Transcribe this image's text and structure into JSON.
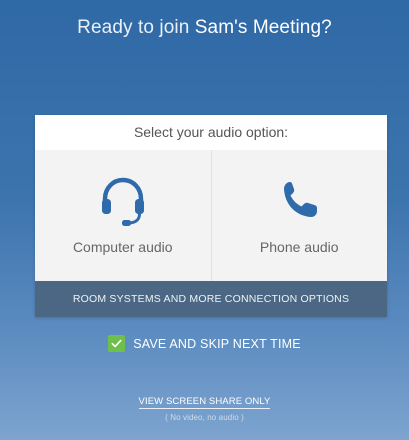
{
  "title": {
    "prefix": "Ready to join ",
    "meeting_name": "Sam's Meeting?"
  },
  "audio_card": {
    "header": "Select your audio option:",
    "options": [
      {
        "label": "Computer audio",
        "icon": "headset-icon"
      },
      {
        "label": "Phone audio",
        "icon": "phone-icon"
      }
    ],
    "room_systems_label": "ROOM SYSTEMS AND MORE CONNECTION OPTIONS"
  },
  "save_skip": {
    "label": "SAVE AND SKIP NEXT TIME",
    "checked": true
  },
  "screen_share": {
    "link_label": "VIEW SCREEN SHARE ONLY",
    "sub_label": "( No video, no audio )"
  },
  "colors": {
    "accent_blue": "#2f6aaa",
    "room_bar": "#4b6784",
    "checkbox_green": "#6fc04b"
  }
}
